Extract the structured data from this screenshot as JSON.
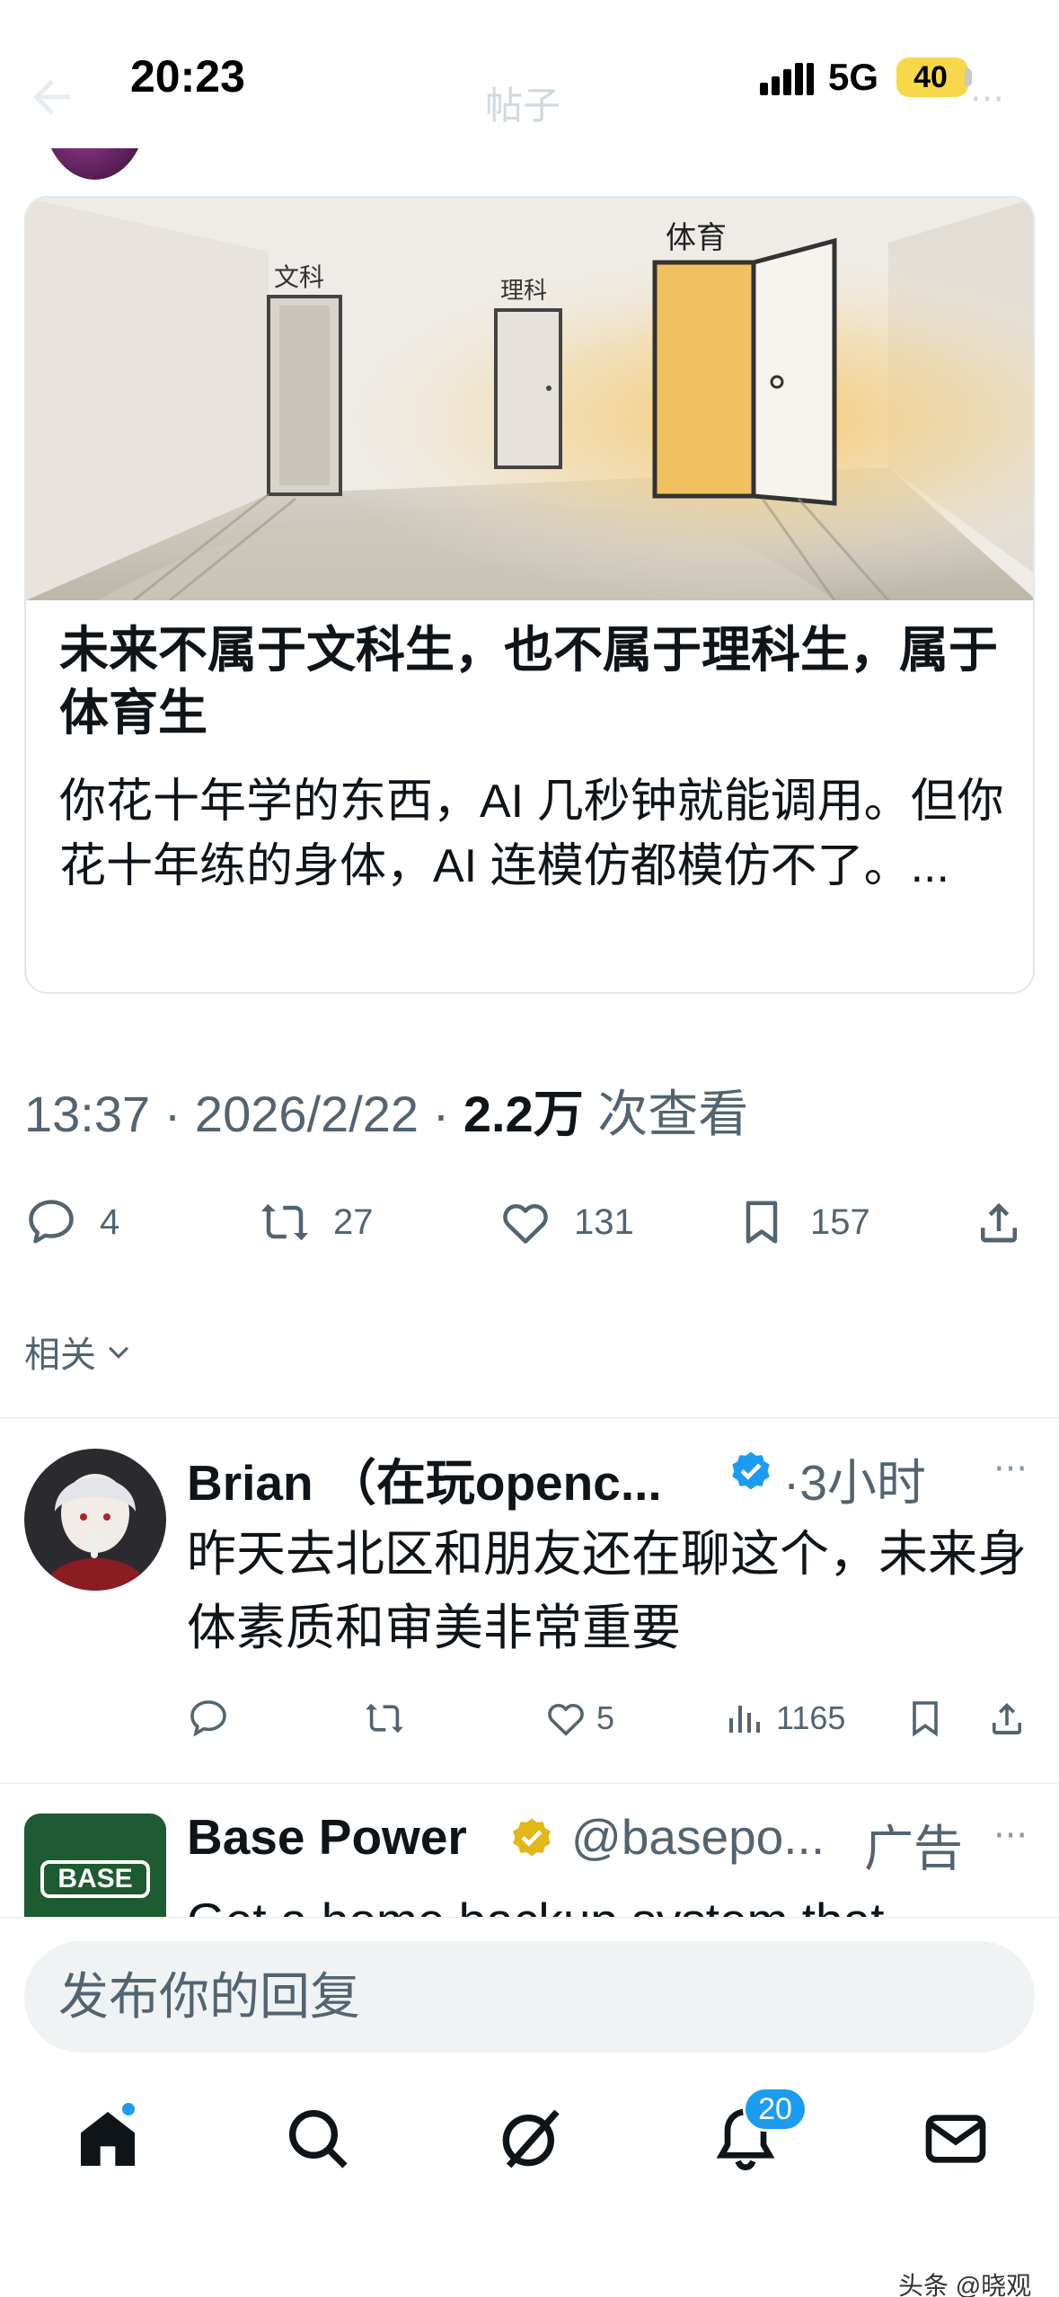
{
  "status_bar": {
    "time": "20:23",
    "network": "5G",
    "battery": "40"
  },
  "nav": {
    "title": "帖子",
    "more": "···"
  },
  "article": {
    "image_labels": {
      "arts": "文科",
      "science": "理科",
      "sports": "体育"
    },
    "title": "未来不属于文科生，也不属于理科生，属于体育生",
    "description": "你花十年学的东西，AI 几秒钟就能调用。但你花十年练的身体，AI 连模仿都模仿不了。..."
  },
  "meta": {
    "time": "13:37",
    "date": "2026/2/22",
    "views": "2.2万",
    "views_label": "次查看",
    "separator": "·"
  },
  "actions": {
    "replies": "4",
    "reposts": "27",
    "likes": "131",
    "bookmarks": "157"
  },
  "related": {
    "label": "相关"
  },
  "replies": [
    {
      "name": "Brian （在玩openc...",
      "time": "·3小时",
      "text": "昨天去北区和朋友还在聊这个，未来身体素质和审美非常重要",
      "likes": "5",
      "views": "1165",
      "more": "···"
    },
    {
      "name": "Base Power",
      "handle": "@basepo...",
      "ad_label": "广告",
      "logo_text": "BASE",
      "text": "Get a home backup system that",
      "more": "···"
    }
  ],
  "composer": {
    "placeholder": "发布你的回复"
  },
  "tabs": {
    "notifications_badge": "20"
  },
  "watermark": "头条 @晓观",
  "colors": {
    "accent": "#1d9bf0",
    "text_primary": "#0f1419",
    "text_secondary": "#536471",
    "battery": "#f8d84a",
    "verified_blue": "#1d9bf0",
    "verified_gold": "#e2b719",
    "base_logo_bg": "#1e5a32"
  }
}
